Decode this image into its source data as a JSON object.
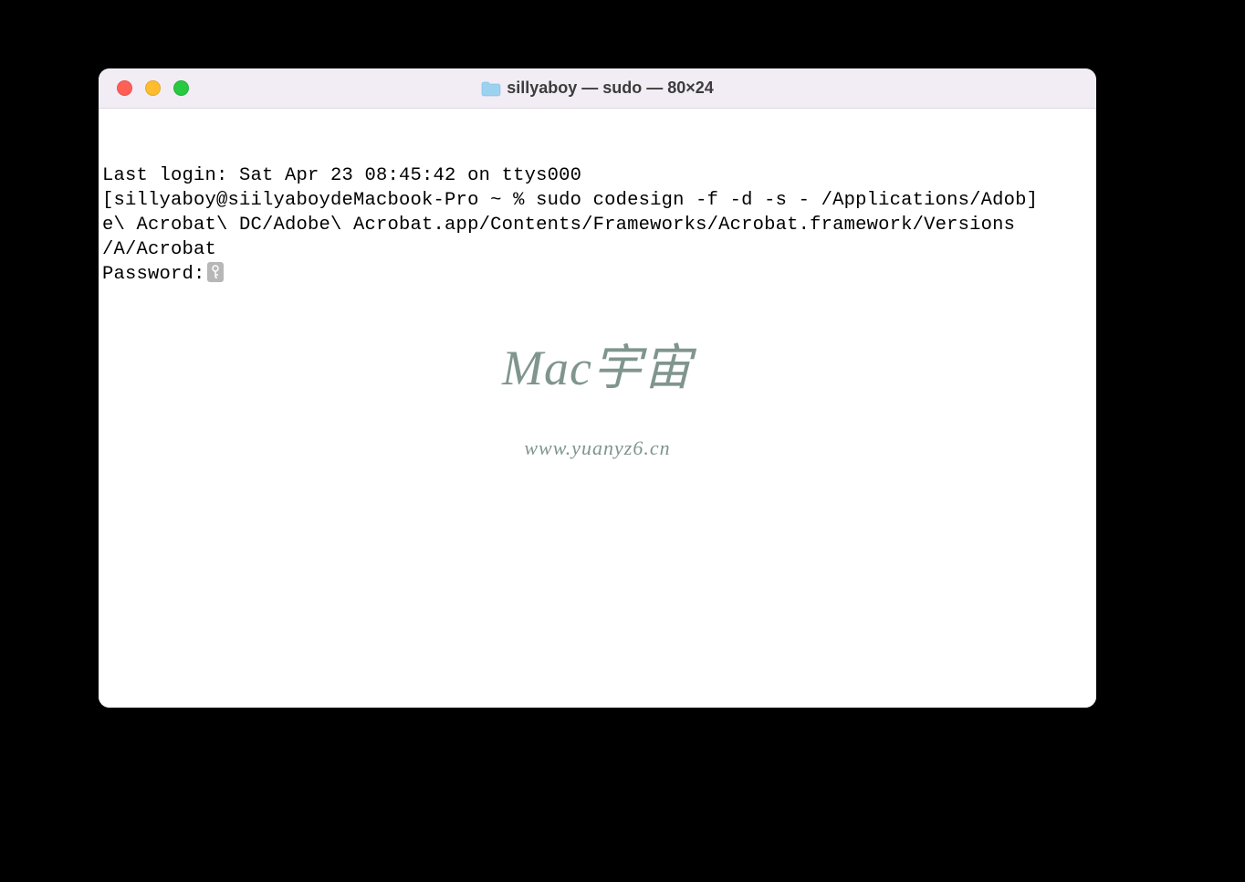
{
  "window": {
    "title": "sillyaboy — sudo — 80×24"
  },
  "terminal": {
    "line1": "Last login: Sat Apr 23 08:45:42 on ttys000",
    "line2": "[sillyaboy@siilyaboydeMacbook-Pro ~ % sudo codesign -f -d -s - /Applications/Adob]",
    "line3": "e\\ Acrobat\\ DC/Adobe\\ Acrobat.app/Contents/Frameworks/Acrobat.framework/Versions",
    "line4": "/A/Acrobat",
    "password_label": "Password:"
  },
  "watermark": {
    "title": "Mac宇宙",
    "url": "www.yuanyz6.cn"
  }
}
